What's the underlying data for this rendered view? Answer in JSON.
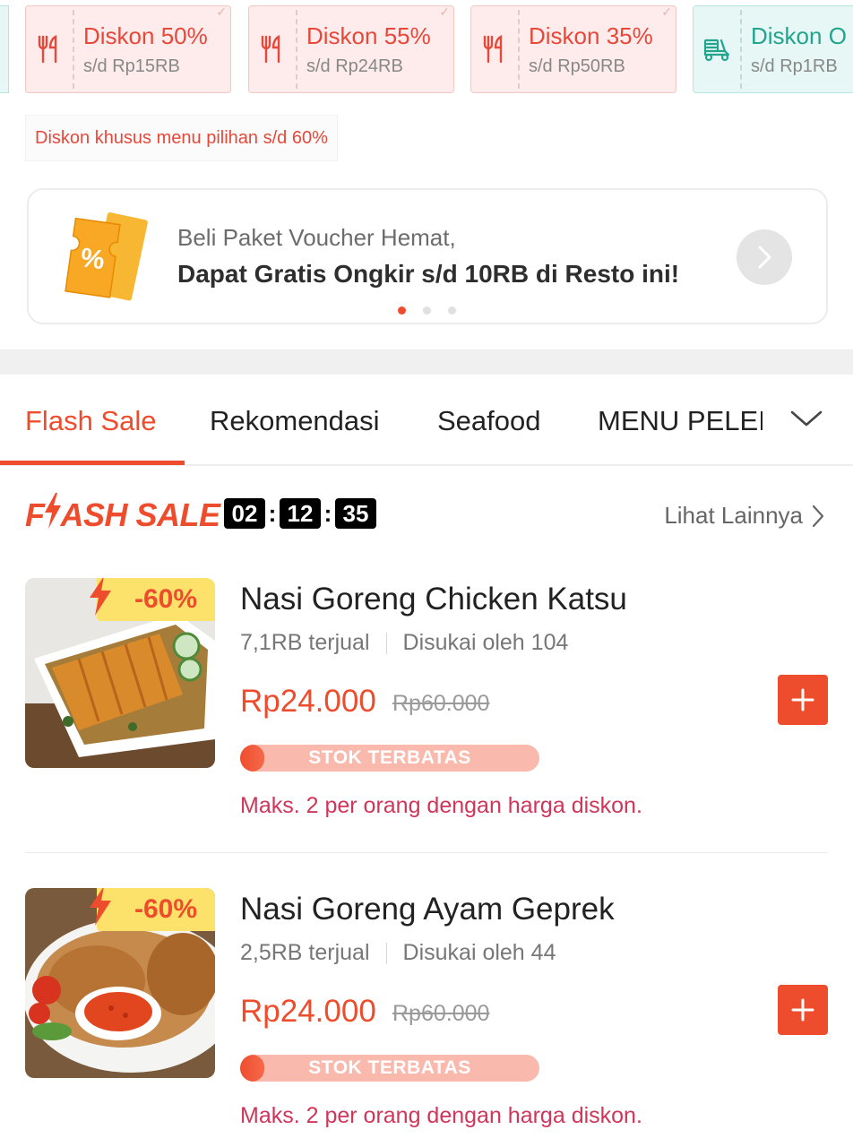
{
  "vouchers": [
    {
      "type": "food",
      "title": "Diskon 50%",
      "subtitle": "s/d Rp15RB",
      "icon": "utensils-icon"
    },
    {
      "type": "food",
      "title": "Diskon 55%",
      "subtitle": "s/d Rp24RB",
      "icon": "utensils-icon"
    },
    {
      "type": "food",
      "title": "Diskon 35%",
      "subtitle": "s/d Rp50RB",
      "icon": "utensils-icon"
    },
    {
      "type": "shipping",
      "title": "Diskon O",
      "subtitle": "s/d Rp1RB",
      "icon": "delivery-scooter-icon"
    }
  ],
  "menu_discount_note": "Diskon khusus menu pilihan s/d 60%",
  "promo_banner": {
    "line1": "Beli Paket Voucher Hemat,",
    "line2": "Dapat Gratis Ongkir s/d 10RB di Resto ini!",
    "icon": "percent-ticket-icon",
    "page_count": 3,
    "active_page": 1
  },
  "tabs": [
    {
      "label": "Flash Sale",
      "active": true
    },
    {
      "label": "Rekomendasi",
      "active": false
    },
    {
      "label": "Seafood",
      "active": false
    },
    {
      "label": "MENU PELEI",
      "active": false
    }
  ],
  "flash_sale": {
    "logo_text_1": "F",
    "logo_text_2": "ASH SALE",
    "timer": {
      "hours": "02",
      "minutes": "12",
      "seconds": "35"
    },
    "see_more_label": "Lihat Lainnya"
  },
  "products": [
    {
      "name": "Nasi Goreng Chicken Katsu",
      "sold": "7,1RB terjual",
      "likes": "Disukai oleh 104",
      "price": "Rp24.000",
      "original_price": "Rp60.000",
      "discount_badge": "-60%",
      "stock_label": "STOK TERBATAS",
      "stock_level": 0.08,
      "limit_note": "Maks. 2 per orang dengan harga diskon."
    },
    {
      "name": "Nasi Goreng Ayam Geprek",
      "sold": "2,5RB terjual",
      "likes": "Disukai oleh 44",
      "price": "Rp24.000",
      "original_price": "Rp60.000",
      "discount_badge": "-60%",
      "stock_label": "STOK TERBATAS",
      "stock_level": 0.08,
      "limit_note": "Maks. 2 per orang dengan harga diskon."
    }
  ],
  "colors": {
    "accent": "#ee4d2d",
    "food_voucher_bg": "#fdeceb",
    "shipping_voucher_text": "#23a48f",
    "badge_yellow": "#fce26b",
    "limit_note": "#d0355a"
  }
}
